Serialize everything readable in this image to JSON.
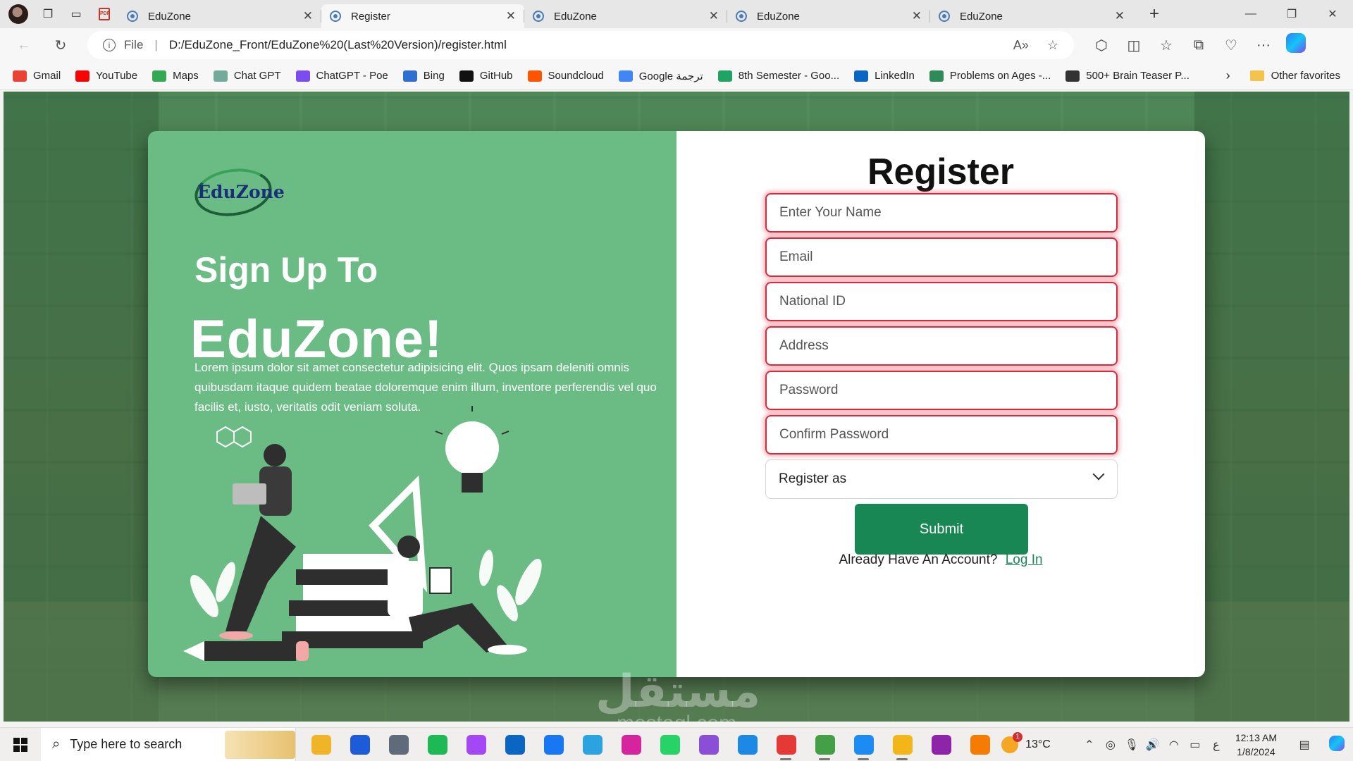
{
  "browser": {
    "tabs": [
      {
        "title": "EduZone",
        "active": false
      },
      {
        "title": "Register",
        "active": true
      },
      {
        "title": "EduZone",
        "active": false
      },
      {
        "title": "EduZone",
        "active": false
      },
      {
        "title": "EduZone",
        "active": false
      }
    ],
    "address": {
      "scheme_label": "File",
      "url": "D:/EduZone_Front/EduZone%20(Last%20Version)/register.html"
    },
    "bookmarks": [
      {
        "label": "Gmail",
        "icon": "gmail-icon",
        "color": "#ea4335"
      },
      {
        "label": "YouTube",
        "icon": "youtube-icon",
        "color": "#ff0000"
      },
      {
        "label": "Maps",
        "icon": "maps-icon",
        "color": "#34a853"
      },
      {
        "label": "Chat GPT",
        "icon": "robot-icon",
        "color": "#74aa9c"
      },
      {
        "label": "ChatGPT - Poe",
        "icon": "poe-icon",
        "color": "#7b4cf0"
      },
      {
        "label": "Bing",
        "icon": "bing-search-icon",
        "color": "#2f6fcf"
      },
      {
        "label": "GitHub",
        "icon": "github-icon",
        "color": "#111111"
      },
      {
        "label": "Soundcloud",
        "icon": "soundcloud-icon",
        "color": "#ff5500"
      },
      {
        "label": "Google ترجمة",
        "icon": "translate-icon",
        "color": "#4285f4"
      },
      {
        "label": "8th Semester - Goo...",
        "icon": "drive-icon",
        "color": "#1fa463"
      },
      {
        "label": "LinkedIn",
        "icon": "linkedin-icon",
        "color": "#0a66c2"
      },
      {
        "label": "Problems on Ages -...",
        "icon": "site-icon",
        "color": "#2e8b57"
      },
      {
        "label": "500+ Brain Teaser P...",
        "icon": "site-icon",
        "color": "#333333"
      }
    ],
    "other_favorites": "Other favorites"
  },
  "page": {
    "logo_text": "EduZone",
    "signup_heading": "Sign Up To",
    "brand_heading": "EduZone!",
    "lorem": "Lorem ipsum dolor sit amet consectetur adipisicing elit. Quos ipsam deleniti omnis quibusdam itaque quidem beatae doloremque enim illum, inventore perferendis vel quo facilis et, iusto, veritatis odit veniam soluta.",
    "form": {
      "title": "Register",
      "fields": [
        {
          "placeholder": "Enter Your Name",
          "value": ""
        },
        {
          "placeholder": "Email",
          "value": ""
        },
        {
          "placeholder": "National ID",
          "value": ""
        },
        {
          "placeholder": "Address",
          "value": ""
        },
        {
          "placeholder": "Password",
          "value": ""
        },
        {
          "placeholder": "Confirm Password",
          "value": ""
        }
      ],
      "register_as": "Register as",
      "submit_label": "Submit",
      "account_prompt": "Already Have An Account?",
      "login_label": "Log In"
    },
    "watermark": "مستقل",
    "watermark_sub": "mostaql.com",
    "colors": {
      "panel_green": "#6abc84",
      "button_green": "#198754",
      "invalid_red": "#d72b3f"
    }
  },
  "taskbar": {
    "search_placeholder": "Type here to search",
    "apps": [
      "file-manager-icon",
      "store-icon",
      "calculator-icon",
      "spotify-icon",
      "messenger-icon",
      "linkedin-icon",
      "facebook-icon",
      "telegram-icon",
      "instagram-icon",
      "whatsapp-icon",
      "visual-studio-icon",
      "vscode-icon",
      "chrome-icon",
      "chrome-profile-icon",
      "edge-icon",
      "explorer-icon",
      "winrar-icon",
      "app-icon"
    ],
    "weather": "13°C",
    "weather_badge": "1",
    "time": "12:13 AM",
    "date": "1/8/2024",
    "lang": "ع"
  }
}
